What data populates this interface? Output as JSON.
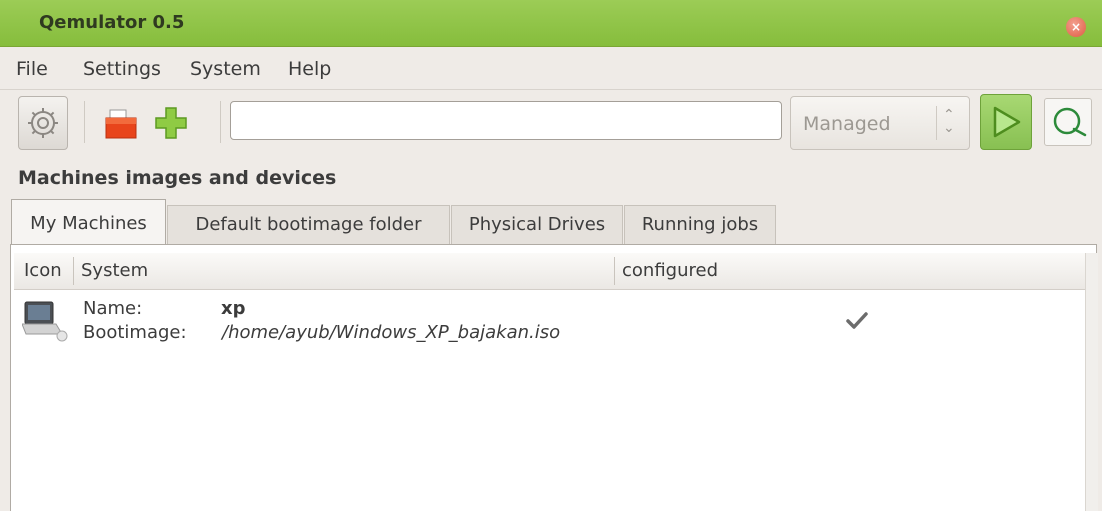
{
  "window": {
    "title": "Qemulator 0.5"
  },
  "menu": {
    "file": "File",
    "settings": "Settings",
    "system": "System",
    "help": "Help"
  },
  "toolbar": {
    "path_value": "",
    "mode_selected": "Managed",
    "icons": [
      "gear-icon",
      "open-folder-icon",
      "add-icon",
      "play-icon",
      "search-monitor-icon"
    ]
  },
  "section_title": "Machines images and devices",
  "tabs": [
    {
      "label": "My Machines"
    },
    {
      "label": "Default bootimage folder"
    },
    {
      "label": "Physical Drives"
    },
    {
      "label": "Running jobs"
    }
  ],
  "table": {
    "columns": [
      "Icon",
      "System",
      "configured"
    ],
    "rows": [
      {
        "name_label": "Name:",
        "name_value": "xp",
        "boot_label": "Bootimage:",
        "boot_value": "/home/ayub/Windows_XP_bajakan.iso",
        "configured_icon": "checkmark-icon"
      }
    ]
  },
  "colors": {
    "titlebar": "#8fc447",
    "close": "#df5b42",
    "run_button": "#95c95f"
  }
}
